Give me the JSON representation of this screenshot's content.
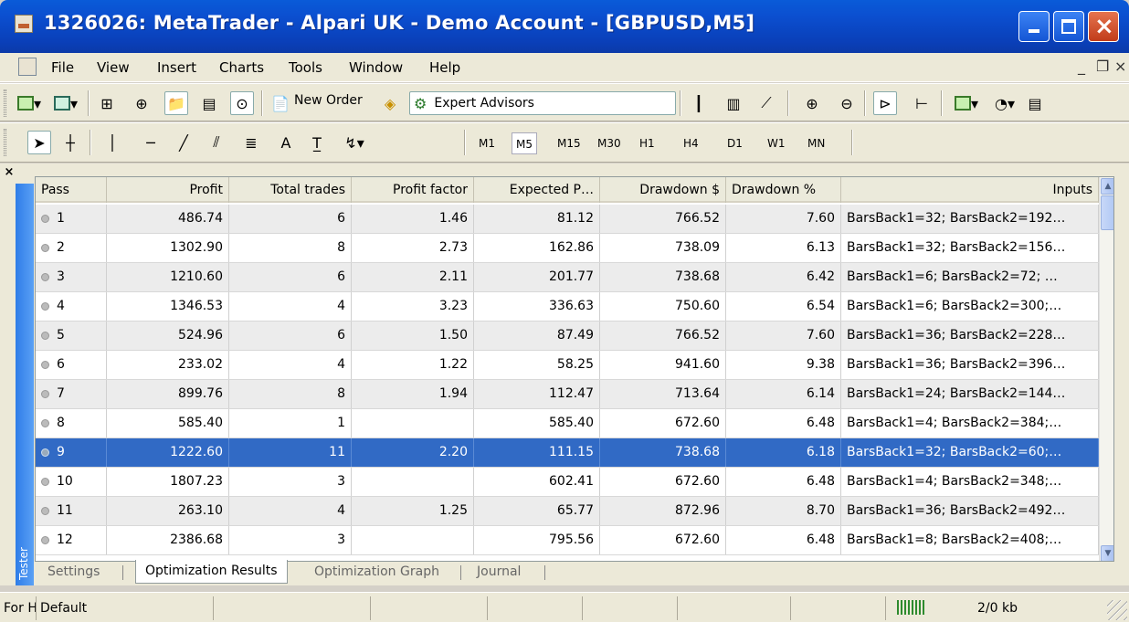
{
  "window": {
    "title": "1326026: MetaTrader - Alpari UK - Demo Account - [GBPUSD,M5]"
  },
  "menu": {
    "items": [
      "File",
      "View",
      "Insert",
      "Charts",
      "Tools",
      "Window",
      "Help"
    ]
  },
  "toolbar": {
    "new_order": "New Order",
    "expert_advisors": "Expert Advisors"
  },
  "timeframes": [
    "M1",
    "M5",
    "M15",
    "M30",
    "H1",
    "H4",
    "D1",
    "W1",
    "MN"
  ],
  "active_timeframe": "M5",
  "draw_tools": {
    "text_label": "A"
  },
  "columns": [
    "Pass",
    "Profit",
    "Total trades",
    "Profit factor",
    "Expected P…",
    "Drawdown $",
    "Drawdown %",
    "Inputs"
  ],
  "rows": [
    {
      "pass": "1",
      "profit": "486.74",
      "trades": "6",
      "pf": "1.46",
      "expected": "81.12",
      "dd": "766.52",
      "ddp": "7.60",
      "inputs": "BarsBack1=32; BarsBack2=192…"
    },
    {
      "pass": "2",
      "profit": "1302.90",
      "trades": "8",
      "pf": "2.73",
      "expected": "162.86",
      "dd": "738.09",
      "ddp": "6.13",
      "inputs": "BarsBack1=32; BarsBack2=156…"
    },
    {
      "pass": "3",
      "profit": "1210.60",
      "trades": "6",
      "pf": "2.11",
      "expected": "201.77",
      "dd": "738.68",
      "ddp": "6.42",
      "inputs": "BarsBack1=6; BarsBack2=72; …"
    },
    {
      "pass": "4",
      "profit": "1346.53",
      "trades": "4",
      "pf": "3.23",
      "expected": "336.63",
      "dd": "750.60",
      "ddp": "6.54",
      "inputs": "BarsBack1=6; BarsBack2=300;…"
    },
    {
      "pass": "5",
      "profit": "524.96",
      "trades": "6",
      "pf": "1.50",
      "expected": "87.49",
      "dd": "766.52",
      "ddp": "7.60",
      "inputs": "BarsBack1=36; BarsBack2=228…"
    },
    {
      "pass": "6",
      "profit": "233.02",
      "trades": "4",
      "pf": "1.22",
      "expected": "58.25",
      "dd": "941.60",
      "ddp": "9.38",
      "inputs": "BarsBack1=36; BarsBack2=396…"
    },
    {
      "pass": "7",
      "profit": "899.76",
      "trades": "8",
      "pf": "1.94",
      "expected": "112.47",
      "dd": "713.64",
      "ddp": "6.14",
      "inputs": "BarsBack1=24; BarsBack2=144…"
    },
    {
      "pass": "8",
      "profit": "585.40",
      "trades": "1",
      "pf": "",
      "expected": "585.40",
      "dd": "672.60",
      "ddp": "6.48",
      "inputs": "BarsBack1=4; BarsBack2=384;…"
    },
    {
      "pass": "9",
      "profit": "1222.60",
      "trades": "11",
      "pf": "2.20",
      "expected": "111.15",
      "dd": "738.68",
      "ddp": "6.18",
      "inputs": "BarsBack1=32; BarsBack2=60;…"
    },
    {
      "pass": "10",
      "profit": "1807.23",
      "trades": "3",
      "pf": "",
      "expected": "602.41",
      "dd": "672.60",
      "ddp": "6.48",
      "inputs": "BarsBack1=4; BarsBack2=348;…"
    },
    {
      "pass": "11",
      "profit": "263.10",
      "trades": "4",
      "pf": "1.25",
      "expected": "65.77",
      "dd": "872.96",
      "ddp": "8.70",
      "inputs": "BarsBack1=36; BarsBack2=492…"
    },
    {
      "pass": "12",
      "profit": "2386.68",
      "trades": "3",
      "pf": "",
      "expected": "795.56",
      "dd": "672.60",
      "ddp": "6.48",
      "inputs": "BarsBack1=8; BarsBack2=408;…"
    }
  ],
  "selected_row": "9",
  "tabs": [
    "Settings",
    "Optimization Results",
    "Optimization Graph",
    "Journal"
  ],
  "active_tab": "Optimization Results",
  "side_label": "Tester",
  "status": {
    "help": "For He",
    "profile": "Default",
    "traffic": "2/0 kb"
  },
  "colors": {
    "title_bar": "#0b4fd0",
    "selection": "#316ac5",
    "tester_strip": "#2f7de8"
  }
}
